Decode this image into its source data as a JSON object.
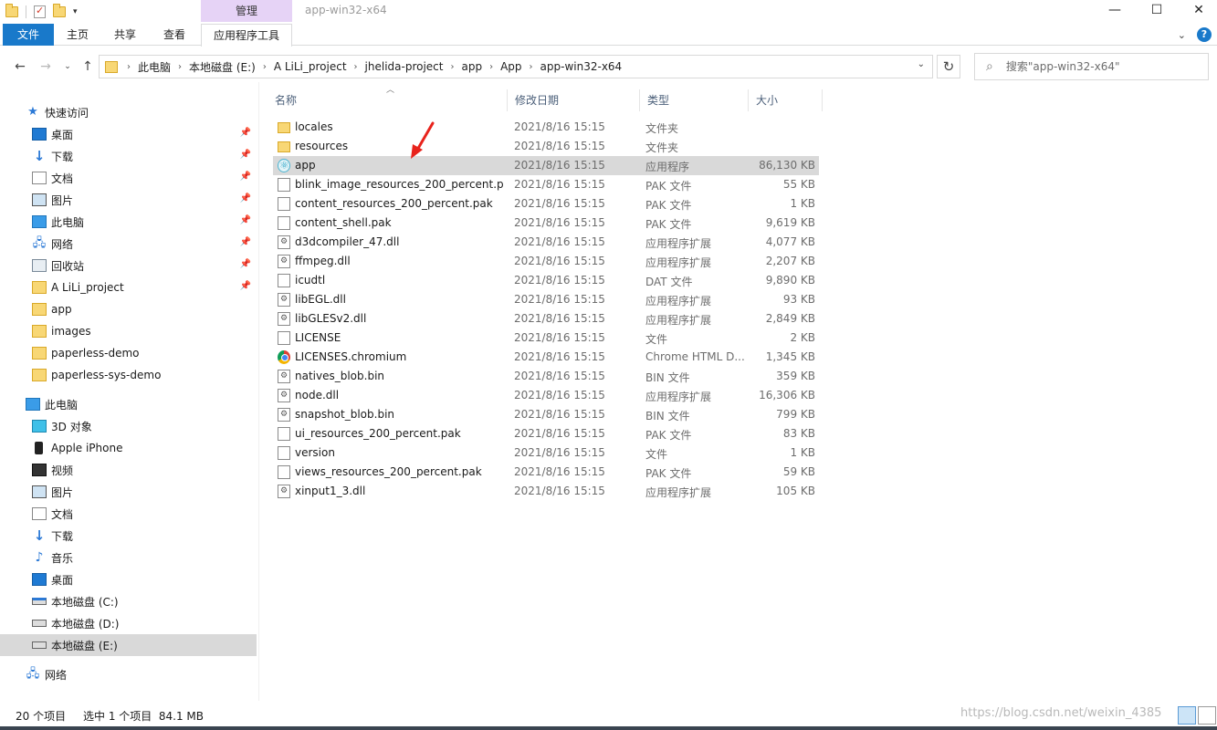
{
  "window": {
    "title": "app-win32-x64",
    "context_tab_group": "管理",
    "controls": {
      "minimize": "—",
      "maximize": "☐",
      "close": "✕"
    }
  },
  "ribbon": {
    "tabs": [
      "文件",
      "主页",
      "共享",
      "查看",
      "应用程序工具"
    ],
    "collapse": "⌄",
    "help": "?"
  },
  "address": {
    "breadcrumbs": [
      "此电脑",
      "本地磁盘 (E:)",
      "A LiLi_project",
      "jhelida-project",
      "app",
      "App",
      "app-win32-x64"
    ],
    "search_placeholder": "搜索\"app-win32-x64\""
  },
  "sidebar": {
    "quick_access": "快速访问",
    "pinned": [
      {
        "label": "桌面",
        "icon": "desktop-icon"
      },
      {
        "label": "下载",
        "icon": "download-icon"
      },
      {
        "label": "文档",
        "icon": "document-icon"
      },
      {
        "label": "图片",
        "icon": "picture-icon"
      },
      {
        "label": "此电脑",
        "icon": "computer-icon"
      },
      {
        "label": "网络",
        "icon": "network-icon"
      },
      {
        "label": "回收站",
        "icon": "recycle-bin-icon"
      },
      {
        "label": "A LiLi_project",
        "icon": "folder-icon"
      }
    ],
    "recent": [
      {
        "label": "app",
        "icon": "folder-icon"
      },
      {
        "label": "images",
        "icon": "folder-icon"
      },
      {
        "label": "paperless-demo",
        "icon": "folder-icon"
      },
      {
        "label": "paperless-sys-demo",
        "icon": "folder-icon"
      }
    ],
    "this_pc": "此电脑",
    "pc_items": [
      {
        "label": "3D 对象",
        "icon": "3d-objects-icon"
      },
      {
        "label": "Apple iPhone",
        "icon": "phone-icon"
      },
      {
        "label": "视频",
        "icon": "video-icon"
      },
      {
        "label": "图片",
        "icon": "picture-icon"
      },
      {
        "label": "文档",
        "icon": "document-icon"
      },
      {
        "label": "下载",
        "icon": "download-icon"
      },
      {
        "label": "音乐",
        "icon": "music-icon"
      },
      {
        "label": "桌面",
        "icon": "desktop-icon"
      },
      {
        "label": "本地磁盘 (C:)",
        "icon": "system-drive-icon"
      },
      {
        "label": "本地磁盘 (D:)",
        "icon": "drive-icon"
      },
      {
        "label": "本地磁盘 (E:)",
        "icon": "drive-icon"
      }
    ],
    "network": "网络"
  },
  "columns": {
    "name": "名称",
    "date": "修改日期",
    "type": "类型",
    "size": "大小"
  },
  "files": [
    {
      "name": "locales",
      "date": "2021/8/16 15:15",
      "type": "文件夹",
      "size": "",
      "icon": "folder"
    },
    {
      "name": "resources",
      "date": "2021/8/16 15:15",
      "type": "文件夹",
      "size": "",
      "icon": "folder"
    },
    {
      "name": "app",
      "date": "2021/8/16 15:15",
      "type": "应用程序",
      "size": "86,130 KB",
      "icon": "app"
    },
    {
      "name": "blink_image_resources_200_percent.p...",
      "date": "2021/8/16 15:15",
      "type": "PAK 文件",
      "size": "55 KB",
      "icon": "file"
    },
    {
      "name": "content_resources_200_percent.pak",
      "date": "2021/8/16 15:15",
      "type": "PAK 文件",
      "size": "1 KB",
      "icon": "file"
    },
    {
      "name": "content_shell.pak",
      "date": "2021/8/16 15:15",
      "type": "PAK 文件",
      "size": "9,619 KB",
      "icon": "file"
    },
    {
      "name": "d3dcompiler_47.dll",
      "date": "2021/8/16 15:15",
      "type": "应用程序扩展",
      "size": "4,077 KB",
      "icon": "dll"
    },
    {
      "name": "ffmpeg.dll",
      "date": "2021/8/16 15:15",
      "type": "应用程序扩展",
      "size": "2,207 KB",
      "icon": "dll"
    },
    {
      "name": "icudtl",
      "date": "2021/8/16 15:15",
      "type": "DAT 文件",
      "size": "9,890 KB",
      "icon": "file"
    },
    {
      "name": "libEGL.dll",
      "date": "2021/8/16 15:15",
      "type": "应用程序扩展",
      "size": "93 KB",
      "icon": "dll"
    },
    {
      "name": "libGLESv2.dll",
      "date": "2021/8/16 15:15",
      "type": "应用程序扩展",
      "size": "2,849 KB",
      "icon": "dll"
    },
    {
      "name": "LICENSE",
      "date": "2021/8/16 15:15",
      "type": "文件",
      "size": "2 KB",
      "icon": "file"
    },
    {
      "name": "LICENSES.chromium",
      "date": "2021/8/16 15:15",
      "type": "Chrome HTML D...",
      "size": "1,345 KB",
      "icon": "chrome"
    },
    {
      "name": "natives_blob.bin",
      "date": "2021/8/16 15:15",
      "type": "BIN 文件",
      "size": "359 KB",
      "icon": "dll"
    },
    {
      "name": "node.dll",
      "date": "2021/8/16 15:15",
      "type": "应用程序扩展",
      "size": "16,306 KB",
      "icon": "dll"
    },
    {
      "name": "snapshot_blob.bin",
      "date": "2021/8/16 15:15",
      "type": "BIN 文件",
      "size": "799 KB",
      "icon": "dll"
    },
    {
      "name": "ui_resources_200_percent.pak",
      "date": "2021/8/16 15:15",
      "type": "PAK 文件",
      "size": "83 KB",
      "icon": "file"
    },
    {
      "name": "version",
      "date": "2021/8/16 15:15",
      "type": "文件",
      "size": "1 KB",
      "icon": "file"
    },
    {
      "name": "views_resources_200_percent.pak",
      "date": "2021/8/16 15:15",
      "type": "PAK 文件",
      "size": "59 KB",
      "icon": "file"
    },
    {
      "name": "xinput1_3.dll",
      "date": "2021/8/16 15:15",
      "type": "应用程序扩展",
      "size": "105 KB",
      "icon": "dll"
    }
  ],
  "selected_file": "app",
  "status": {
    "item_count": "20 个项目",
    "selection": "选中 1 个项目  84.1 MB"
  },
  "watermark": "https://blog.csdn.net/weixin_4385",
  "colors": {
    "accent": "#1979ca",
    "selection": "#d9d9d9",
    "context_tab": "#e6d3f6",
    "annotation_arrow": "#e8231c"
  }
}
